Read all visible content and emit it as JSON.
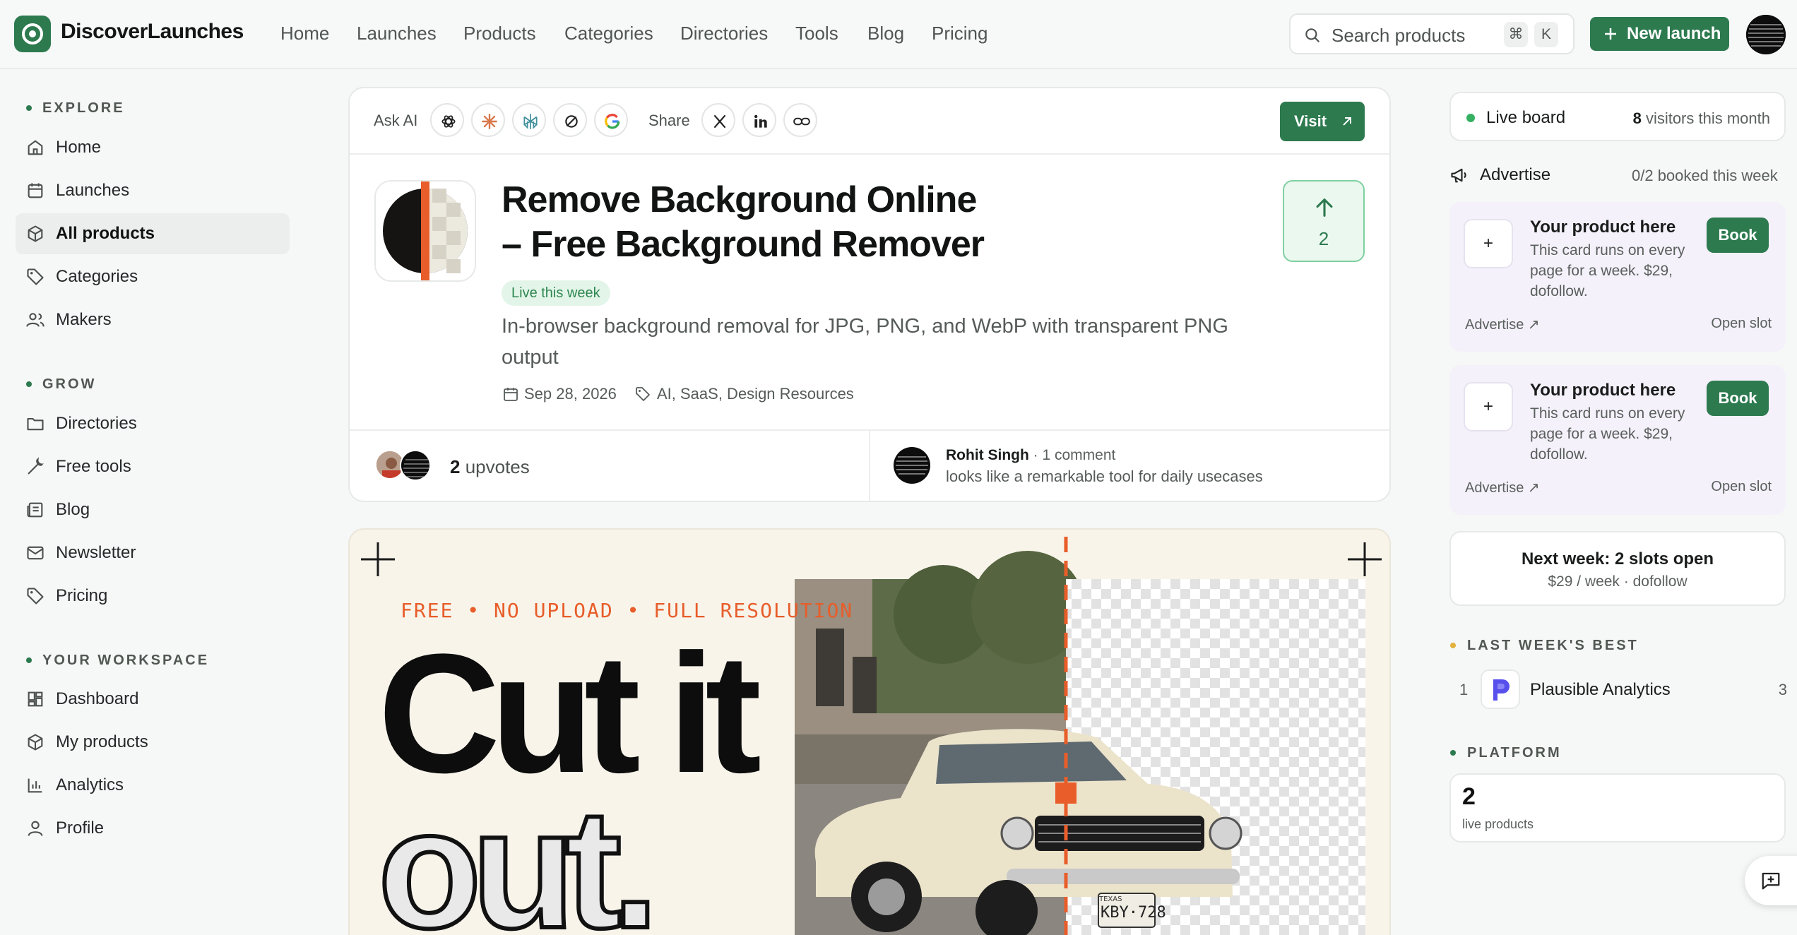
{
  "app": {
    "name": "DiscoverLaunches"
  },
  "nav": [
    "Home",
    "Launches",
    "Products",
    "Categories",
    "Directories",
    "Tools",
    "Blog",
    "Pricing"
  ],
  "search": {
    "placeholder": "Search products",
    "kbd1": "⌘",
    "kbd2": "K"
  },
  "new_launch": "New launch",
  "sidebar": {
    "explore": {
      "heading": "EXPLORE",
      "items": [
        "Home",
        "Launches",
        "All products",
        "Categories",
        "Makers"
      ]
    },
    "grow": {
      "heading": "GROW",
      "items": [
        "Directories",
        "Free tools",
        "Blog",
        "Newsletter",
        "Pricing"
      ]
    },
    "workspace": {
      "heading": "YOUR WORKSPACE",
      "items": [
        "Dashboard",
        "My products",
        "Analytics",
        "Profile"
      ]
    },
    "active_item": "All products"
  },
  "actionbar": {
    "ask_ai": "Ask AI",
    "share": "Share",
    "visit": "Visit"
  },
  "product": {
    "title_line1": "Remove Background Online",
    "title_line2": "– Free Background Remover",
    "badge": "Live this week",
    "description": "In-browser background removal for JPG, PNG, and WebP with transparent PNG output",
    "date": "Sep 28, 2026",
    "tags": "AI, SaaS, Design Resources",
    "upvote_count": "2"
  },
  "engagement": {
    "upvotes_count": "2",
    "upvotes_label": "upvotes",
    "commenter": "Rohit Singh",
    "comment_count": "· 1 comment",
    "comment": "looks like a remarkable tool for daily usecases"
  },
  "hero": {
    "tagline": "FREE • NO UPLOAD • FULL RESOLUTION",
    "headline1": "Cut it",
    "headline2": "out.",
    "plate_state": "TEXAS",
    "plate": "KBY·728"
  },
  "right": {
    "live_board": "Live board",
    "visitors_num": "8",
    "visitors_label": "visitors this month",
    "advertise": "Advertise",
    "booked": "0/2 booked this week",
    "slots": [
      {
        "title": "Your product here",
        "desc": "This card runs on every page for a week. $29, dofollow.",
        "book": "Book",
        "link": "Advertise ↗",
        "status": "Open slot"
      },
      {
        "title": "Your product here",
        "desc": "This card runs on every page for a week. $29, dofollow.",
        "book": "Book",
        "link": "Advertise ↗",
        "status": "Open slot"
      }
    ],
    "next_week_title": "Next week: 2 slots open",
    "next_week_sub": "$29 / week · dofollow",
    "last_week_heading": "LAST WEEK'S BEST",
    "last_week_rank": "1",
    "last_week_name": "Plausible Analytics",
    "last_week_count": "3",
    "platform_heading": "PLATFORM",
    "platform_num": "2",
    "platform_label": "live products"
  },
  "colors": {
    "accent": "#2d7a4f",
    "orange": "#e85d2a"
  }
}
